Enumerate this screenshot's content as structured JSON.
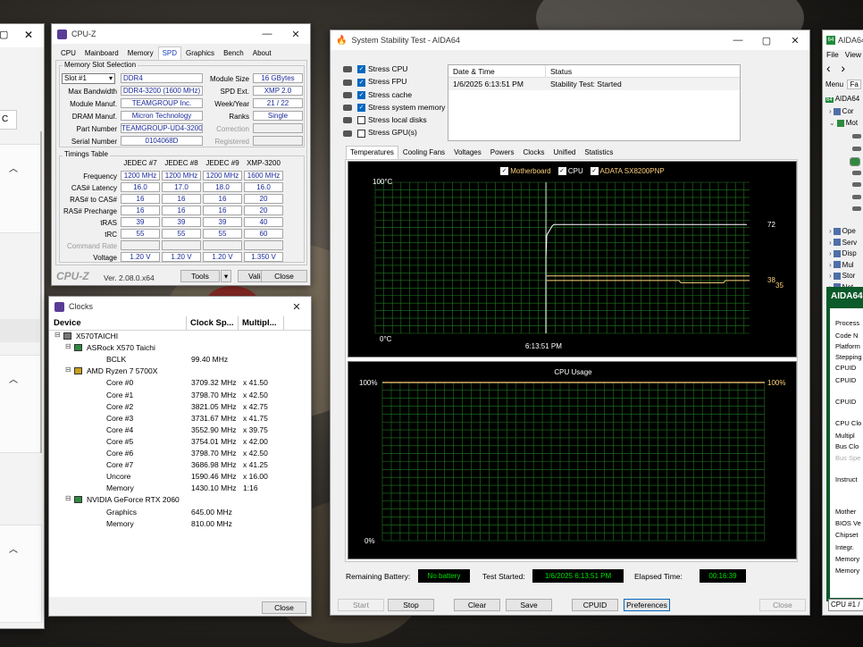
{
  "leftwin": {
    "field": "C"
  },
  "cpuz": {
    "title": "CPU-Z",
    "tabs": [
      "CPU",
      "Mainboard",
      "Memory",
      "SPD",
      "Graphics",
      "Bench",
      "About"
    ],
    "active_tab": "SPD",
    "slot_section": "Memory Slot Selection",
    "slot": "Slot #1",
    "type": "DDR4",
    "module_size_label": "Module Size",
    "module_size": "16 GBytes",
    "max_bw_label": "Max Bandwidth",
    "max_bw": "DDR4-3200 (1600 MHz)",
    "spd_ext_label": "SPD Ext.",
    "spd_ext": "XMP 2.0",
    "manuf_label": "Module Manuf.",
    "manuf": "TEAMGROUP Inc.",
    "week_label": "Week/Year",
    "week": "21 / 22",
    "dram_label": "DRAM Manuf.",
    "dram": "Micron Technology",
    "ranks_label": "Ranks",
    "ranks": "Single",
    "part_label": "Part Number",
    "part": "TEAMGROUP-UD4-3200",
    "correction_label": "Correction",
    "serial_label": "Serial Number",
    "serial": "0104068D",
    "registered_label": "Registered",
    "timings_section": "Timings Table",
    "cols": [
      "JEDEC #7",
      "JEDEC #8",
      "JEDEC #9",
      "XMP-3200"
    ],
    "rows": [
      {
        "label": "Frequency",
        "v": [
          "1200 MHz",
          "1200 MHz",
          "1200 MHz",
          "1600 MHz"
        ]
      },
      {
        "label": "CAS# Latency",
        "v": [
          "16.0",
          "17.0",
          "18.0",
          "16.0"
        ]
      },
      {
        "label": "RAS# to CAS#",
        "v": [
          "16",
          "16",
          "16",
          "20"
        ]
      },
      {
        "label": "RAS# Precharge",
        "v": [
          "16",
          "16",
          "16",
          "20"
        ]
      },
      {
        "label": "tRAS",
        "v": [
          "39",
          "39",
          "39",
          "40"
        ]
      },
      {
        "label": "tRC",
        "v": [
          "55",
          "55",
          "55",
          "60"
        ]
      },
      {
        "label": "Command Rate",
        "v": [
          "",
          "",
          "",
          ""
        ]
      },
      {
        "label": "Voltage",
        "v": [
          "1.20 V",
          "1.20 V",
          "1.20 V",
          "1.350 V"
        ]
      }
    ],
    "brand": "CPU-Z",
    "version": "Ver. 2.08.0.x64",
    "tools": "Tools",
    "validate": "Validate",
    "close": "Close"
  },
  "clocks": {
    "title": "Clocks",
    "h_device": "Device",
    "h_clock": "Clock Sp...",
    "h_mult": "Multipl...",
    "rows": [
      {
        "indent": 0,
        "name": "X570TAICHI",
        "clock": "",
        "mult": ""
      },
      {
        "indent": 1,
        "name": "ASRock X570 Taichi",
        "clock": "",
        "mult": ""
      },
      {
        "indent": 2,
        "name": "BCLK",
        "clock": "99.40 MHz",
        "mult": ""
      },
      {
        "indent": 1,
        "name": "AMD Ryzen 7 5700X",
        "clock": "",
        "mult": ""
      },
      {
        "indent": 2,
        "name": "Core #0",
        "clock": "3709.32 MHz",
        "mult": "x 41.50"
      },
      {
        "indent": 2,
        "name": "Core #1",
        "clock": "3798.70 MHz",
        "mult": "x 42.50"
      },
      {
        "indent": 2,
        "name": "Core #2",
        "clock": "3821.05 MHz",
        "mult": "x 42.75"
      },
      {
        "indent": 2,
        "name": "Core #3",
        "clock": "3731.67 MHz",
        "mult": "x 41.75"
      },
      {
        "indent": 2,
        "name": "Core #4",
        "clock": "3552.90 MHz",
        "mult": "x 39.75"
      },
      {
        "indent": 2,
        "name": "Core #5",
        "clock": "3754.01 MHz",
        "mult": "x 42.00"
      },
      {
        "indent": 2,
        "name": "Core #6",
        "clock": "3798.70 MHz",
        "mult": "x 42.50"
      },
      {
        "indent": 2,
        "name": "Core #7",
        "clock": "3686.98 MHz",
        "mult": "x 41.25"
      },
      {
        "indent": 2,
        "name": "Uncore",
        "clock": "1590.46 MHz",
        "mult": "x 16.00"
      },
      {
        "indent": 2,
        "name": "Memory",
        "clock": "1430.10 MHz",
        "mult": "1:16"
      },
      {
        "indent": 1,
        "name": "NVIDIA GeForce RTX 2060",
        "clock": "",
        "mult": ""
      },
      {
        "indent": 2,
        "name": "Graphics",
        "clock": "645.00 MHz",
        "mult": ""
      },
      {
        "indent": 2,
        "name": "Memory",
        "clock": "810.00 MHz",
        "mult": ""
      }
    ],
    "close": "Close"
  },
  "sst": {
    "title": "System Stability Test - AIDA64",
    "stress": [
      {
        "label": "Stress CPU",
        "on": true
      },
      {
        "label": "Stress FPU",
        "on": true
      },
      {
        "label": "Stress cache",
        "on": true
      },
      {
        "label": "Stress system memory",
        "on": true
      },
      {
        "label": "Stress local disks",
        "on": false
      },
      {
        "label": "Stress GPU(s)",
        "on": false
      }
    ],
    "log_h_date": "Date & Time",
    "log_h_status": "Status",
    "log_date": "1/6/2025 6:13:51 PM",
    "log_status": "Stability Test: Started",
    "tabs": [
      "Temperatures",
      "Cooling Fans",
      "Voltages",
      "Powers",
      "Clocks",
      "Unified",
      "Statistics"
    ],
    "active_tab": "Temperatures",
    "legend": [
      "Motherboard",
      "CPU",
      "ADATA SX8200PNP"
    ],
    "temp_ymax": "100°C",
    "temp_ymin": "0°C",
    "temp_time": "6:13:51 PM",
    "val_cpu": "72",
    "val_mb": "38",
    "val_ssd": "35",
    "usage_title": "CPU Usage",
    "usage_ymax": "100%",
    "usage_ymin": "0%",
    "usage_val": "100%",
    "battery_label": "Remaining Battery:",
    "battery": "No battery",
    "started_label": "Test Started:",
    "started": "1/6/2025 6:13:51 PM",
    "elapsed_label": "Elapsed Time:",
    "elapsed": "00:16:39",
    "btn_start": "Start",
    "btn_stop": "Stop",
    "btn_clear": "Clear",
    "btn_save": "Save",
    "btn_cpuid": "CPUID",
    "btn_prefs": "Preferences",
    "btn_close": "Close"
  },
  "aida": {
    "title": "AIDA64",
    "menu": [
      "File",
      "View"
    ],
    "menu_tab": "Menu",
    "fav_tab": "Fa",
    "tree_root": "AIDA64",
    "tree": [
      "Cor",
      "Mot",
      "Ope",
      "Serv",
      "Disp",
      "Mul",
      "Stor",
      "Net"
    ],
    "banner": "AIDA64",
    "fields": [
      "Process",
      "Code N",
      "Platform",
      "Stepping",
      "CPUID",
      "CPUID",
      "CPUID",
      "CPU Clo",
      "Multipl",
      "Bus Clo",
      "Bus Spe",
      "Instruct",
      "Mother",
      "BIOS Ve",
      "Chipset",
      "Integr.",
      "Memory",
      "Memory"
    ],
    "cpu_select": "CPU #1 /"
  }
}
